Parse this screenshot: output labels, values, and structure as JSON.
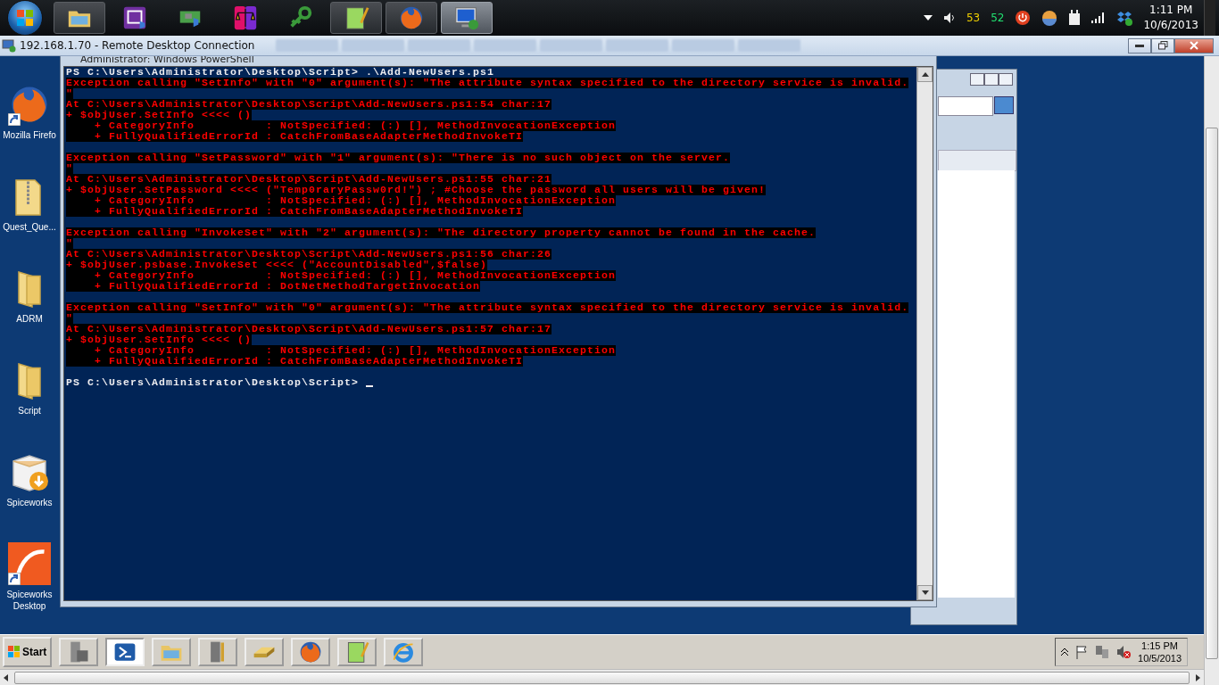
{
  "host_taskbar": {
    "buttons": [
      {
        "kind": "explorer",
        "running": true,
        "selected": false
      },
      {
        "kind": "cpu-tool",
        "running": false,
        "selected": false
      },
      {
        "kind": "network-card",
        "running": false,
        "selected": false
      },
      {
        "kind": "scales",
        "running": false,
        "selected": false
      },
      {
        "kind": "key",
        "running": false,
        "selected": false
      },
      {
        "kind": "notepad",
        "running": true,
        "selected": false
      },
      {
        "kind": "firefox",
        "running": true,
        "selected": false
      },
      {
        "kind": "remote-desktop",
        "running": true,
        "selected": true
      }
    ],
    "indicators": [
      {
        "text": "53",
        "color": "#f0d000"
      },
      {
        "text": "52",
        "color": "#20e070"
      }
    ],
    "time": "1:11 PM",
    "date": "10/6/2013"
  },
  "rdp_bar": {
    "title": "192.168.1.70 - Remote Desktop Connection"
  },
  "desktop_icons": [
    {
      "kind": "firefox",
      "label": "Mozilla Firefo",
      "shortcut": true
    },
    {
      "kind": "zip-folder",
      "label": "Quest_Que...",
      "shortcut": false
    },
    {
      "kind": "folder",
      "label": "ADRM",
      "shortcut": false
    },
    {
      "kind": "folder",
      "label": "Script",
      "shortcut": false
    },
    {
      "kind": "installer",
      "label": "Spiceworks",
      "shortcut": false
    },
    {
      "kind": "spiceworks",
      "label": "Spiceworks Desktop",
      "shortcut": true
    }
  ],
  "console": {
    "title": "Administrator: Windows PowerShell",
    "lines": [
      {
        "kind": "prompt",
        "text": "PS C:\\Users\\Administrator\\Desktop\\Script> .\\Add-NewUsers.ps1"
      },
      {
        "kind": "error",
        "text": "Exception calling \"SetInfo\" with \"0\" argument(s): \"The attribute syntax specified to the directory service is invalid."
      },
      {
        "kind": "error",
        "text": "\""
      },
      {
        "kind": "error",
        "text": "At C:\\Users\\Administrator\\Desktop\\Script\\Add-NewUsers.ps1:54 char:17"
      },
      {
        "kind": "error",
        "text": "+ $objUser.SetInfo <<<< ()"
      },
      {
        "kind": "error",
        "text": "    + CategoryInfo          : NotSpecified: (:) [], MethodInvocationException"
      },
      {
        "kind": "error",
        "text": "    + FullyQualifiedErrorId : CatchFromBaseAdapterMethodInvokeTI"
      },
      {
        "kind": "blank"
      },
      {
        "kind": "error",
        "text": "Exception calling \"SetPassword\" with \"1\" argument(s): \"There is no such object on the server."
      },
      {
        "kind": "error",
        "text": "\""
      },
      {
        "kind": "error",
        "text": "At C:\\Users\\Administrator\\Desktop\\Script\\Add-NewUsers.ps1:55 char:21"
      },
      {
        "kind": "error",
        "text": "+ $objUser.SetPassword <<<< (\"Temp0raryPassw0rd!\") ; #Choose the password all users will be given!"
      },
      {
        "kind": "error",
        "text": "    + CategoryInfo          : NotSpecified: (:) [], MethodInvocationException"
      },
      {
        "kind": "error",
        "text": "    + FullyQualifiedErrorId : CatchFromBaseAdapterMethodInvokeTI"
      },
      {
        "kind": "blank"
      },
      {
        "kind": "error",
        "text": "Exception calling \"InvokeSet\" with \"2\" argument(s): \"The directory property cannot be found in the cache."
      },
      {
        "kind": "error",
        "text": "\""
      },
      {
        "kind": "error",
        "text": "At C:\\Users\\Administrator\\Desktop\\Script\\Add-NewUsers.ps1:56 char:26"
      },
      {
        "kind": "error",
        "text": "+ $objUser.psbase.InvokeSet <<<< (\"AccountDisabled\",$false)"
      },
      {
        "kind": "error",
        "text": "    + CategoryInfo          : NotSpecified: (:) [], MethodInvocationException"
      },
      {
        "kind": "error",
        "text": "    + FullyQualifiedErrorId : DotNetMethodTargetInvocation"
      },
      {
        "kind": "blank"
      },
      {
        "kind": "error",
        "text": "Exception calling \"SetInfo\" with \"0\" argument(s): \"The attribute syntax specified to the directory service is invalid."
      },
      {
        "kind": "error",
        "text": "\""
      },
      {
        "kind": "error",
        "text": "At C:\\Users\\Administrator\\Desktop\\Script\\Add-NewUsers.ps1:57 char:17"
      },
      {
        "kind": "error",
        "text": "+ $objUser.SetInfo <<<< ()"
      },
      {
        "kind": "error",
        "text": "    + CategoryInfo          : NotSpecified: (:) [], MethodInvocationException"
      },
      {
        "kind": "error",
        "text": "    + FullyQualifiedErrorId : CatchFromBaseAdapterMethodInvokeTI"
      },
      {
        "kind": "blank"
      },
      {
        "kind": "prompt",
        "text": "PS C:\\Users\\Administrator\\Desktop\\Script> ",
        "cursor": true
      }
    ]
  },
  "remote_taskbar": {
    "start": "Start",
    "buttons": [
      {
        "kind": "server-manager",
        "selected": false
      },
      {
        "kind": "powershell",
        "selected": true
      },
      {
        "kind": "explorer",
        "selected": false
      },
      {
        "kind": "tools",
        "selected": false
      },
      {
        "kind": "drive",
        "selected": false
      },
      {
        "kind": "firefox",
        "selected": false
      },
      {
        "kind": "notepad",
        "selected": false
      },
      {
        "kind": "internet-explorer",
        "selected": false
      }
    ],
    "time": "1:15 PM",
    "date": "10/5/2013"
  }
}
